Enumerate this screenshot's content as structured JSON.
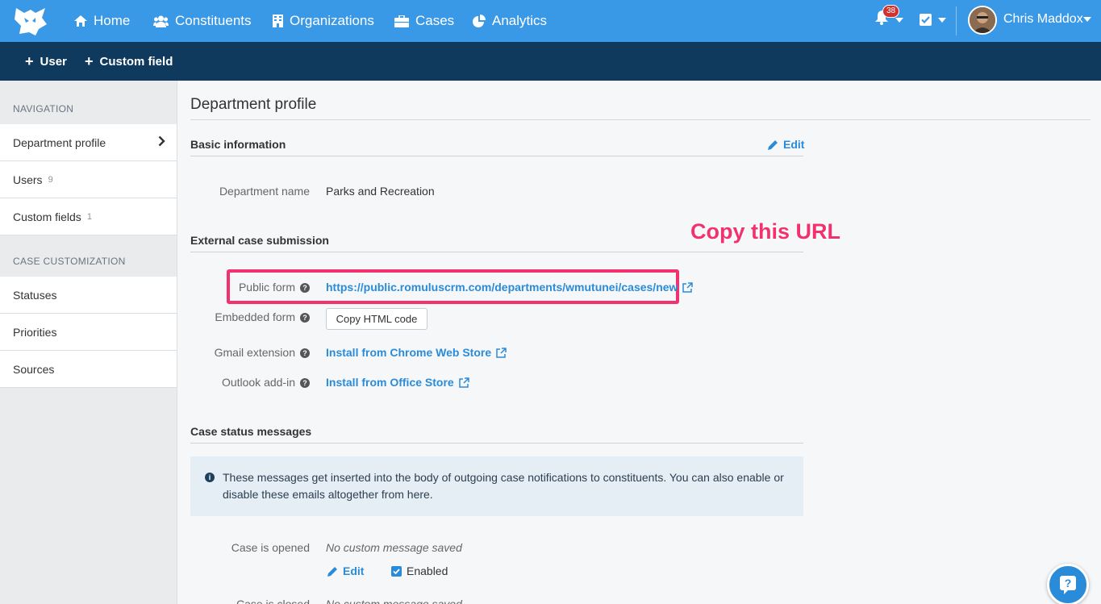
{
  "topnav": {
    "items": [
      {
        "label": "Home",
        "icon": "home-icon"
      },
      {
        "label": "Constituents",
        "icon": "users-icon"
      },
      {
        "label": "Organizations",
        "icon": "building-icon"
      },
      {
        "label": "Cases",
        "icon": "briefcase-icon"
      },
      {
        "label": "Analytics",
        "icon": "pie-chart-icon"
      }
    ],
    "notification_count": "38",
    "user_name": "Chris Maddox"
  },
  "subnav": {
    "user_label": "User",
    "custom_field_label": "Custom field"
  },
  "sidebar": {
    "nav_heading": "NAVIGATION",
    "nav_items": [
      {
        "label": "Department profile",
        "count": ""
      },
      {
        "label": "Users",
        "count": "9"
      },
      {
        "label": "Custom fields",
        "count": "1"
      }
    ],
    "case_heading": "CASE CUSTOMIZATION",
    "case_items": [
      {
        "label": "Statuses"
      },
      {
        "label": "Priorities"
      },
      {
        "label": "Sources"
      }
    ]
  },
  "main": {
    "page_title": "Department profile",
    "basic_info": {
      "title": "Basic information",
      "edit_label": "Edit",
      "dept_name_label": "Department name",
      "dept_name_value": "Parks and Recreation"
    },
    "external": {
      "title": "External case submission",
      "public_form_label": "Public form",
      "public_form_url": "https://public.romuluscrm.com/departments/wmutunei/cases/new",
      "embedded_form_label": "Embedded form",
      "copy_html_label": "Copy HTML code",
      "gmail_label": "Gmail extension",
      "gmail_link": "Install from Chrome Web Store",
      "outlook_label": "Outlook add-in",
      "outlook_link": "Install from Office Store",
      "annotation": "Copy this URL"
    },
    "status_messages": {
      "title": "Case status messages",
      "info_text": "These messages get inserted into the body of outgoing case notifications to constituents. You can also enable or disable these emails altogether from here.",
      "case_opened_label": "Case is opened",
      "case_opened_value": "No custom message saved",
      "edit_label": "Edit",
      "enabled_label": "Enabled",
      "case_closed_label": "Case is closed",
      "case_closed_value": "No custom message saved"
    }
  },
  "colors": {
    "topbar": "#3a99e6",
    "subbar": "#0f3a5d",
    "link": "#2a8bd9",
    "annotation": "#f2326f"
  }
}
